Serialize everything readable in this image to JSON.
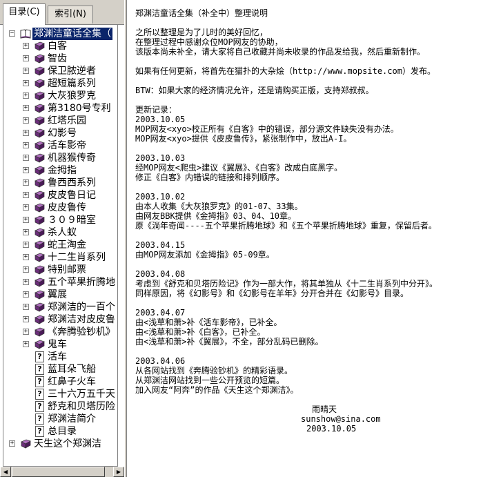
{
  "tabs": [
    {
      "label": "目录(C)",
      "active": true
    },
    {
      "label": "索引(N)",
      "active": false
    }
  ],
  "tree": {
    "root": {
      "label": "郑渊洁童话全集（",
      "expanded": true,
      "selected": true
    },
    "books": [
      "白客",
      "智齿",
      "保卫脓逆者",
      "超短篇系列",
      "大灰狼罗克",
      "第3180号专利",
      "红塔乐园",
      "幻影号",
      "活车影帝",
      "机器猴传奇",
      "金拇指",
      "鲁西西系列",
      "皮皮鲁日记",
      "皮皮鲁传",
      "３０９暗室",
      "杀人蚁",
      "蛇王淘金",
      "十二生肖系列",
      "特别邮票",
      "五个苹果折腾地",
      "翼展",
      "郑渊洁的一百个",
      "郑渊洁对皮皮鲁",
      "《奔腾验钞机》",
      "鬼车"
    ],
    "pages": [
      "活车",
      "蓝耳朵飞船",
      "红鼻子火车",
      "三十六万五千天",
      "舒克和贝塔历险",
      "郑渊洁简介",
      "总目录"
    ],
    "last": {
      "label": "天生这个郑渊洁"
    },
    "expander_plus": "+",
    "expander_minus": "−",
    "page_glyph": "?"
  },
  "icons": {
    "book_closed": "book-closed-icon",
    "book_open": "book-open-icon",
    "help_page": "help-page-icon"
  },
  "colors": {
    "selection": "#0a246a",
    "book_purple": "#6b2d7a",
    "chrome": "#d4d0c8"
  },
  "content": {
    "title": "郑渊洁童话全集（补全中）整理说明",
    "intro": [
      "之所以整理是为了儿时的美好回忆，",
      "在整理过程中感谢众位MOP网友的协助，",
      "该版本尚未补全，请大家将自己收藏并尚未收录的作品发给我，然后重新制作。"
    ],
    "update_note": "如果有任何更新，将首先在猫扑的大杂烩（http://www.mopsite.com）发布。",
    "btw": "BTW：如果大家的经济情况允许，还是请购买正版，支持郑叔叔。",
    "log_title": "更新记录：",
    "log": [
      {
        "date": "2003.10.05",
        "lines": [
          "MOP网友<xyo>校正所有《白客》中的错误，部分源文件缺失没有办法。",
          "MOP网友<xyo>提供《皮皮鲁传》，紧张制作中，放出A-I。"
        ]
      },
      {
        "date": "2003.10.03",
        "lines": [
          "经MOP网友<爬虫>建议《翼展》、《白客》改成白底黑字。",
          "修正《白客》内错误的链接和排列顺序。"
        ]
      },
      {
        "date": "2003.10.02",
        "lines": [
          "由本人收集《大灰狼罗克》的01-07、33集。",
          "由网友BBK提供《金拇指》03、04、10章。",
          "原《淌年奇闻----五个苹果折腾地球》和《五个苹果折腾地球》重复，保留后者。"
        ]
      },
      {
        "date": "2003.04.15",
        "lines": [
          "由MOP网友添加《金拇指》05-09章。"
        ]
      },
      {
        "date": "2003.04.08",
        "lines": [
          "考虑到《舒克和贝塔历险记》作为一部大作，将其单独从《十二生肖系列中分开》。",
          "同样原因，将《幻影号》和《幻影号在羊年》分开合并在《幻影号》目录。"
        ]
      },
      {
        "date": "2003.04.07",
        "lines": [
          "由<浅草和萧>补《活车影帝》，已补全。",
          "由<浅草和萧>补《白客》，已补全。",
          "由<浅草和萧>补《翼展》，不全，部分乱码已删除。"
        ]
      },
      {
        "date": "2003.04.06",
        "lines": [
          "从各网站找到《奔腾验钞机》的精彩语录。",
          "从郑渊洁网站找到一些公开预览的短篇。",
          "加入网友“阿奔”的作品《天生这个郑渊洁》。"
        ]
      }
    ],
    "signature": {
      "name": "雨晴天",
      "email": "sunshow@sina.com",
      "date": "2003.10.05"
    }
  }
}
